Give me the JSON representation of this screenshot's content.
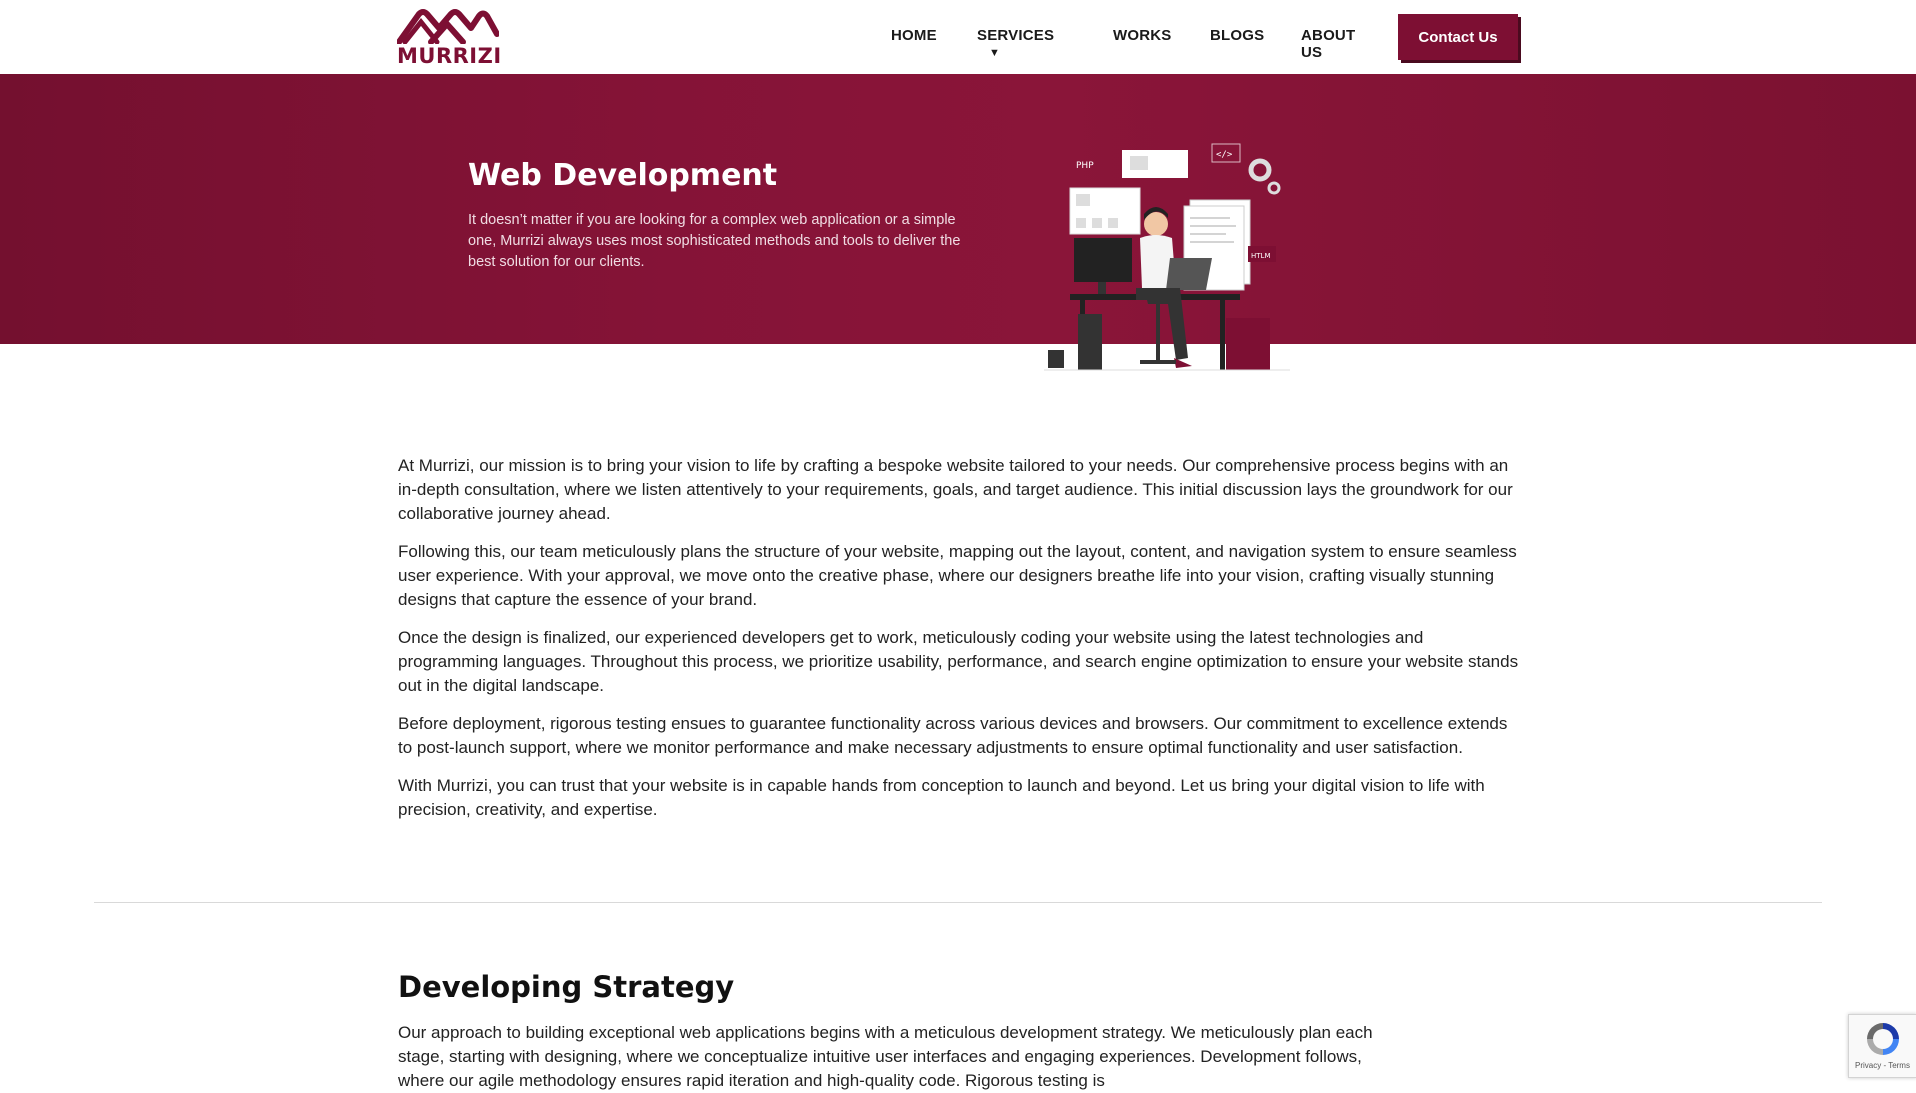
{
  "brand": {
    "name": "MURRIZI",
    "color": "#7d0f33"
  },
  "nav": {
    "items": [
      {
        "label": "HOME"
      },
      {
        "label": "SERVICES",
        "caret": "▼"
      },
      {
        "label": "WORKS"
      },
      {
        "label": "BLOGS"
      },
      {
        "label": "ABOUT US"
      }
    ],
    "contact_label": "Contact Us"
  },
  "hero": {
    "title": "Web Development",
    "description": "It doesn’t matter if you are looking for a complex web application or a simple one, Murrizi always uses most sophisticated methods and tools to deliver the best solution for our clients.",
    "illustration_labels": {
      "php": "PHP",
      "html": "HTLM",
      "code": "</>"
    }
  },
  "content": {
    "paragraphs": [
      "At Murrizi, our mission is to bring your vision to life by crafting a bespoke website tailored to your needs. Our comprehensive process begins with an in-depth consultation, where we listen attentively to your requirements, goals, and target audience. This initial discussion lays the groundwork for our collaborative journey ahead.",
      "Following this, our team meticulously plans the structure of your website, mapping out the layout, content, and navigation system to ensure seamless user experience. With your approval, we move onto the creative phase, where our designers breathe life into your vision, crafting visually stunning designs that capture the essence of your brand.",
      "Once the design is finalized, our experienced developers get to work, meticulously coding your website using the latest technologies and programming languages. Throughout this process, we prioritize usability, performance, and search engine optimization to ensure your website stands out in the digital landscape.",
      "Before deployment, rigorous testing ensues to guarantee functionality across various devices and browsers. Our commitment to excellence extends to post-launch support, where we monitor performance and make necessary adjustments to ensure optimal functionality and user satisfaction.",
      "With Murrizi, you can trust that your website is in capable hands from conception to launch and beyond. Let us bring your digital vision to life with precision, creativity, and expertise."
    ]
  },
  "strategy": {
    "title": "Developing Strategy",
    "text": "Our approach to building exceptional web applications begins with a meticulous development strategy. We meticulously plan each stage, starting with designing, where we conceptualize intuitive user interfaces and engaging experiences. Development follows, where our agile methodology ensures rapid iteration and high-quality code. Rigorous testing is"
  },
  "recaptcha": {
    "links": "Privacy - Terms"
  },
  "colors": {
    "accent": "#7d0f33",
    "hero_bg": "#851337"
  }
}
